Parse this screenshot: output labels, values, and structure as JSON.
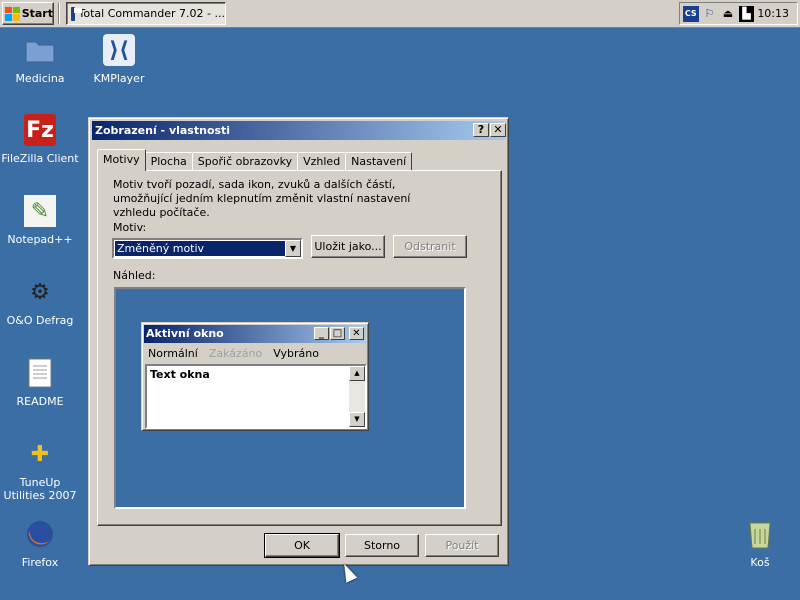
{
  "taskbar": {
    "start_label": "Start",
    "task_label": "Total Commander 7.02 - ...",
    "clock": "10:13"
  },
  "desktop": {
    "icons": [
      {
        "label": "Medicina",
        "icon": "folder-icon"
      },
      {
        "label": "KMPlayer",
        "icon": "kmplayer-icon"
      },
      {
        "label": "FileZilla Client",
        "icon": "filezilla-icon"
      },
      {
        "label": "Notepad++",
        "icon": "notepad-icon"
      },
      {
        "label": "O&O Defrag",
        "icon": "defrag-icon"
      },
      {
        "label": "README",
        "icon": "document-icon"
      },
      {
        "label": "TuneUp Utilities 2007",
        "icon": "tuneup-icon"
      },
      {
        "label": "Firefox",
        "icon": "firefox-icon"
      },
      {
        "label": "Koš",
        "icon": "recycle-bin-icon"
      }
    ]
  },
  "dialog": {
    "title": "Zobrazení - vlastnosti",
    "tabs": [
      "Motivy",
      "Plocha",
      "Spořič obrazovky",
      "Vzhled",
      "Nastavení"
    ],
    "description": "Motiv tvoří pozadí, sada ikon, zvuků a dalších částí, umožňující jedním klepnutím změnit vlastní nastavení vzhledu počítače.",
    "motiv_label": "Motiv:",
    "motiv_value": "Změněný motiv",
    "save_as": "Uložit jako...",
    "remove": "Odstranit",
    "preview_label": "Náhled:",
    "preview": {
      "window_title": "Aktivní okno",
      "menu_normal": "Normální",
      "menu_disabled": "Zakázáno",
      "menu_selected": "Vybráno",
      "text": "Text okna"
    },
    "ok": "OK",
    "cancel": "Storno",
    "apply": "Použít"
  },
  "colors": {
    "desktop": "#3a6ea5",
    "title_active": "#0a246a",
    "face": "#d4d0c8"
  }
}
